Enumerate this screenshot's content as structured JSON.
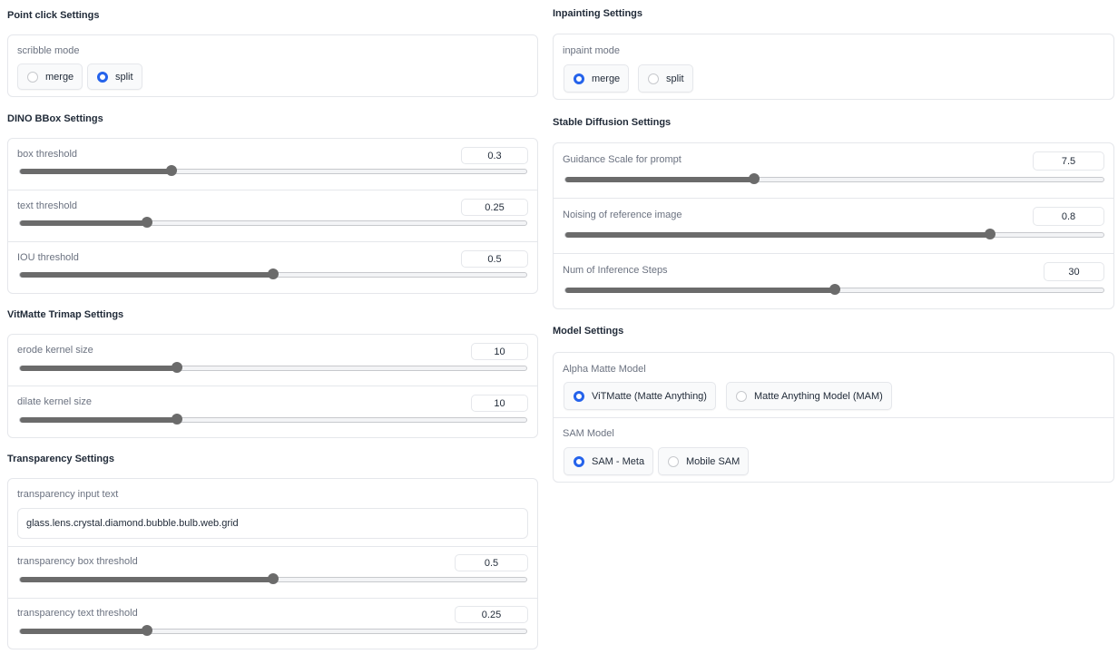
{
  "left": {
    "point_click": {
      "title": "Point click Settings",
      "scribble_label": "scribble mode",
      "options": [
        "merge",
        "split"
      ],
      "selected": "split"
    },
    "dino": {
      "title": "DINO BBox Settings",
      "sliders": [
        {
          "label": "box threshold",
          "value": "0.3",
          "level": 0.3
        },
        {
          "label": "text threshold",
          "value": "0.25",
          "level": 0.25
        },
        {
          "label": "IOU threshold",
          "value": "0.5",
          "level": 0.5
        }
      ]
    },
    "vitmatte": {
      "title": "VitMatte Trimap Settings",
      "sliders": [
        {
          "label": "erode kernel size",
          "value": "10",
          "level": 0.31
        },
        {
          "label": "dilate kernel size",
          "value": "10",
          "level": 0.31
        }
      ]
    },
    "transparency": {
      "title": "Transparency Settings",
      "input_label": "transparency input text",
      "input_value": "glass.lens.crystal.diamond.bubble.bulb.web.grid",
      "sliders": [
        {
          "label": "transparency box threshold",
          "value": "0.5",
          "level": 0.5
        },
        {
          "label": "transparency text threshold",
          "value": "0.25",
          "level": 0.25
        }
      ]
    }
  },
  "right": {
    "inpainting": {
      "title": "Inpainting Settings",
      "mode_label": "inpaint mode",
      "options": [
        "merge",
        "split"
      ],
      "selected": "merge"
    },
    "stable_diffusion": {
      "title": "Stable Diffusion Settings",
      "sliders": [
        {
          "label": "Guidance Scale for prompt",
          "value": "7.5",
          "level": 0.35
        },
        {
          "label": "Noising of reference image",
          "value": "0.8",
          "level": 0.79
        },
        {
          "label": "Num of Inference Steps",
          "value": "30",
          "level": 0.5
        }
      ]
    },
    "model": {
      "title": "Model Settings",
      "alpha_label": "Alpha Matte Model",
      "alpha_options": [
        "ViTMatte (Matte Anything)",
        "Matte Anything Model (MAM)"
      ],
      "alpha_selected": "ViTMatte (Matte Anything)",
      "sam_label": "SAM Model",
      "sam_options": [
        "SAM - Meta",
        "Mobile SAM"
      ],
      "sam_selected": "SAM - Meta"
    }
  },
  "colors": {
    "accent": "#2563eb",
    "slider_fill": "#6b6b6b",
    "border": "#e5e7eb"
  }
}
